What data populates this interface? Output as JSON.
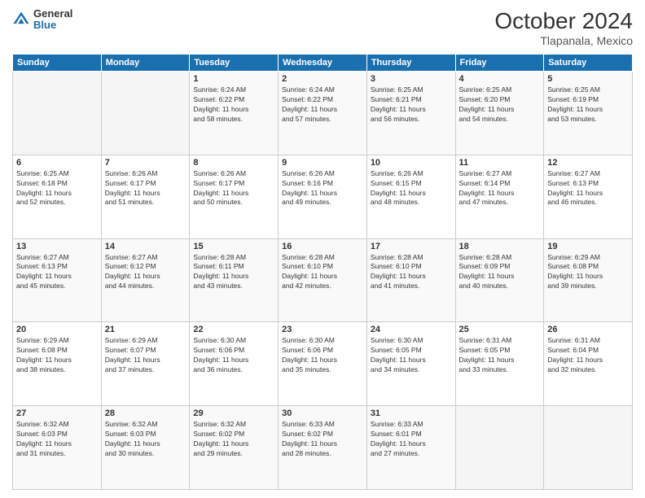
{
  "logo": {
    "general": "General",
    "blue": "Blue"
  },
  "title": "October 2024",
  "location": "Tlapanala, Mexico",
  "days_header": [
    "Sunday",
    "Monday",
    "Tuesday",
    "Wednesday",
    "Thursday",
    "Friday",
    "Saturday"
  ],
  "weeks": [
    [
      {
        "num": "",
        "info": ""
      },
      {
        "num": "",
        "info": ""
      },
      {
        "num": "1",
        "info": "Sunrise: 6:24 AM\nSunset: 6:22 PM\nDaylight: 11 hours\nand 58 minutes."
      },
      {
        "num": "2",
        "info": "Sunrise: 6:24 AM\nSunset: 6:22 PM\nDaylight: 11 hours\nand 57 minutes."
      },
      {
        "num": "3",
        "info": "Sunrise: 6:25 AM\nSunset: 6:21 PM\nDaylight: 11 hours\nand 56 minutes."
      },
      {
        "num": "4",
        "info": "Sunrise: 6:25 AM\nSunset: 6:20 PM\nDaylight: 11 hours\nand 54 minutes."
      },
      {
        "num": "5",
        "info": "Sunrise: 6:25 AM\nSunset: 6:19 PM\nDaylight: 11 hours\nand 53 minutes."
      }
    ],
    [
      {
        "num": "6",
        "info": "Sunrise: 6:25 AM\nSunset: 6:18 PM\nDaylight: 11 hours\nand 52 minutes."
      },
      {
        "num": "7",
        "info": "Sunrise: 6:26 AM\nSunset: 6:17 PM\nDaylight: 11 hours\nand 51 minutes."
      },
      {
        "num": "8",
        "info": "Sunrise: 6:26 AM\nSunset: 6:17 PM\nDaylight: 11 hours\nand 50 minutes."
      },
      {
        "num": "9",
        "info": "Sunrise: 6:26 AM\nSunset: 6:16 PM\nDaylight: 11 hours\nand 49 minutes."
      },
      {
        "num": "10",
        "info": "Sunrise: 6:26 AM\nSunset: 6:15 PM\nDaylight: 11 hours\nand 48 minutes."
      },
      {
        "num": "11",
        "info": "Sunrise: 6:27 AM\nSunset: 6:14 PM\nDaylight: 11 hours\nand 47 minutes."
      },
      {
        "num": "12",
        "info": "Sunrise: 6:27 AM\nSunset: 6:13 PM\nDaylight: 11 hours\nand 46 minutes."
      }
    ],
    [
      {
        "num": "13",
        "info": "Sunrise: 6:27 AM\nSunset: 6:13 PM\nDaylight: 11 hours\nand 45 minutes."
      },
      {
        "num": "14",
        "info": "Sunrise: 6:27 AM\nSunset: 6:12 PM\nDaylight: 11 hours\nand 44 minutes."
      },
      {
        "num": "15",
        "info": "Sunrise: 6:28 AM\nSunset: 6:11 PM\nDaylight: 11 hours\nand 43 minutes."
      },
      {
        "num": "16",
        "info": "Sunrise: 6:28 AM\nSunset: 6:10 PM\nDaylight: 11 hours\nand 42 minutes."
      },
      {
        "num": "17",
        "info": "Sunrise: 6:28 AM\nSunset: 6:10 PM\nDaylight: 11 hours\nand 41 minutes."
      },
      {
        "num": "18",
        "info": "Sunrise: 6:28 AM\nSunset: 6:09 PM\nDaylight: 11 hours\nand 40 minutes."
      },
      {
        "num": "19",
        "info": "Sunrise: 6:29 AM\nSunset: 6:08 PM\nDaylight: 11 hours\nand 39 minutes."
      }
    ],
    [
      {
        "num": "20",
        "info": "Sunrise: 6:29 AM\nSunset: 6:08 PM\nDaylight: 11 hours\nand 38 minutes."
      },
      {
        "num": "21",
        "info": "Sunrise: 6:29 AM\nSunset: 6:07 PM\nDaylight: 11 hours\nand 37 minutes."
      },
      {
        "num": "22",
        "info": "Sunrise: 6:30 AM\nSunset: 6:06 PM\nDaylight: 11 hours\nand 36 minutes."
      },
      {
        "num": "23",
        "info": "Sunrise: 6:30 AM\nSunset: 6:06 PM\nDaylight: 11 hours\nand 35 minutes."
      },
      {
        "num": "24",
        "info": "Sunrise: 6:30 AM\nSunset: 6:05 PM\nDaylight: 11 hours\nand 34 minutes."
      },
      {
        "num": "25",
        "info": "Sunrise: 6:31 AM\nSunset: 6:05 PM\nDaylight: 11 hours\nand 33 minutes."
      },
      {
        "num": "26",
        "info": "Sunrise: 6:31 AM\nSunset: 6:04 PM\nDaylight: 11 hours\nand 32 minutes."
      }
    ],
    [
      {
        "num": "27",
        "info": "Sunrise: 6:32 AM\nSunset: 6:03 PM\nDaylight: 11 hours\nand 31 minutes."
      },
      {
        "num": "28",
        "info": "Sunrise: 6:32 AM\nSunset: 6:03 PM\nDaylight: 11 hours\nand 30 minutes."
      },
      {
        "num": "29",
        "info": "Sunrise: 6:32 AM\nSunset: 6:02 PM\nDaylight: 11 hours\nand 29 minutes."
      },
      {
        "num": "30",
        "info": "Sunrise: 6:33 AM\nSunset: 6:02 PM\nDaylight: 11 hours\nand 28 minutes."
      },
      {
        "num": "31",
        "info": "Sunrise: 6:33 AM\nSunset: 6:01 PM\nDaylight: 11 hours\nand 27 minutes."
      },
      {
        "num": "",
        "info": ""
      },
      {
        "num": "",
        "info": ""
      }
    ]
  ]
}
